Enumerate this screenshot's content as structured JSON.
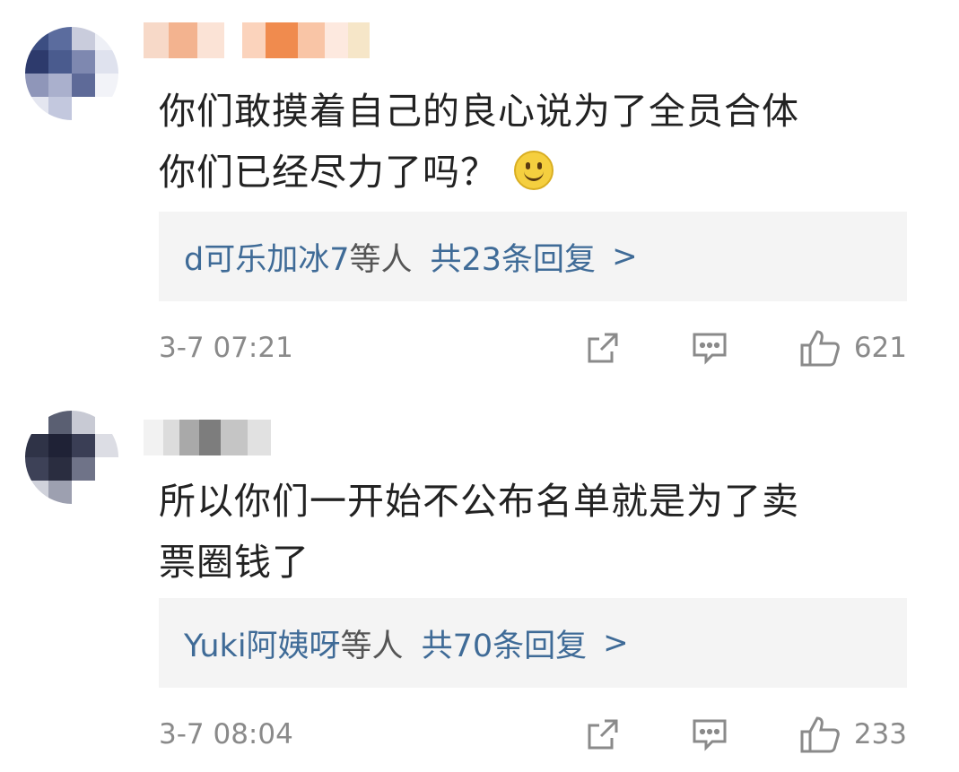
{
  "colors": {
    "link": "#3f6b97",
    "muted": "#8a8a8a",
    "text": "#222222",
    "reply_bg": "#f4f4f4"
  },
  "comments": [
    {
      "text_line1": "你们敢摸着自己的良心说为了全员合体",
      "text_line2": "你们已经尽力了吗？",
      "emoji": "smile-emoji",
      "replies_users": "d可乐加冰7",
      "replies_suffix": "等人",
      "replies_count": "共23条回复",
      "replies_chevron": ">",
      "time": "3-7 07:21",
      "likes": "621"
    },
    {
      "text_line1": "所以你们一开始不公布名单就是为了卖",
      "text_line2": "票圈钱了",
      "replies_users": "Yuki阿姨呀",
      "replies_suffix": "等人",
      "replies_count": "共70条回复",
      "replies_chevron": ">",
      "time": "3-7 08:04",
      "likes": "233"
    }
  ],
  "icons": {
    "share": "share-icon",
    "comment": "comment-icon",
    "like": "thumbs-up-icon"
  }
}
